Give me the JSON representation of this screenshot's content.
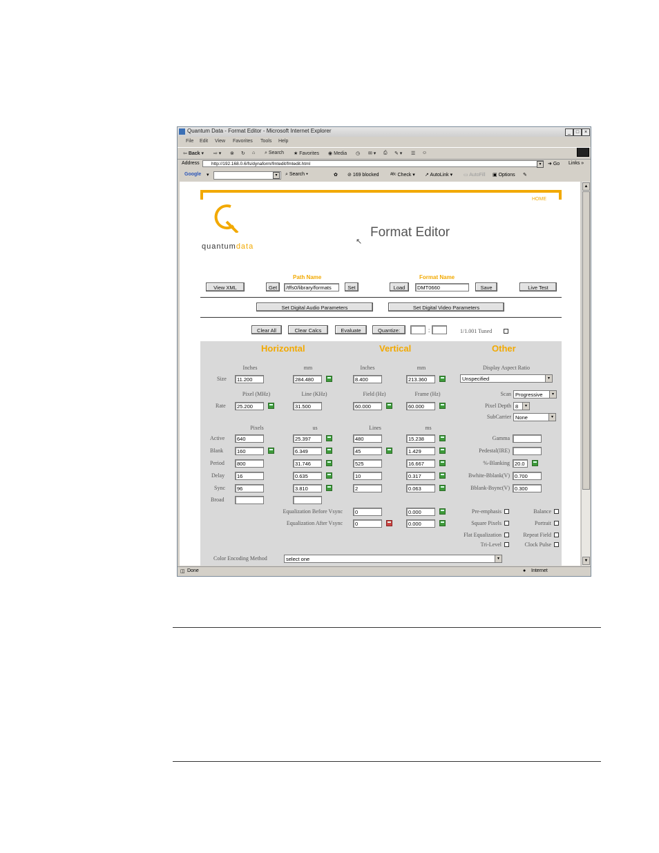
{
  "window": {
    "title": "Quantum Data - Format Editor - Microsoft Internet Explorer",
    "menu": [
      "File",
      "Edit",
      "View",
      "Favorites",
      "Tools",
      "Help"
    ],
    "toolbar": {
      "back": "Back",
      "search": "Search",
      "favorites": "Favorites",
      "media": "Media"
    },
    "address_label": "Address",
    "address": "http://192.168.0.6/fs/dynaform/fmtedit/fmtedit.html",
    "go": "Go",
    "links": "Links",
    "google": {
      "logo": "Google",
      "search": "Search",
      "blocked": "169 blocked",
      "check": "Check",
      "autolink": "AutoLink",
      "autofill": "AutoFill",
      "options": "Options"
    },
    "status": {
      "done": "Done",
      "zone": "Internet"
    }
  },
  "page": {
    "home": "HOME",
    "logo_text": "quantum",
    "logo_text2": "data",
    "title": "Format Editor",
    "path_label": "Path Name",
    "format_label": "Format Name",
    "view_xml": "View XML",
    "get": "Get",
    "path_value": "/tffs0/library/formats",
    "set": "Set",
    "load": "Load",
    "format_value": "DMT0660",
    "save": "Save",
    "live_test": "Live Test",
    "set_audio": "Set Digital Audio Parameters",
    "set_video": "Set Digital Video Parameters",
    "clear_all": "Clear All",
    "clear_calcs": "Clear Calcs",
    "evaluate": "Evaluate",
    "quantize": "Quantize:",
    "quantize_sep": ":",
    "tuned": "1/1.001 Tuned"
  },
  "sections": {
    "horizontal": "Horizontal",
    "vertical": "Vertical",
    "other": "Other"
  },
  "size": {
    "label": "Size",
    "h_inches_hdr": "Inches",
    "h_mm_hdr": "mm",
    "v_inches_hdr": "Inches",
    "v_mm_hdr": "mm",
    "h_inches": "11.200",
    "h_mm": "284.480",
    "v_inches": "8.400",
    "v_mm": "213.360",
    "aspect_hdr": "Display Aspect Ratio",
    "aspect": "Unspecified"
  },
  "rate": {
    "label": "Rate",
    "pixel_hdr": "Pixel (MHz)",
    "line_hdr": "Line (KHz)",
    "field_hdr": "Field (Hz)",
    "frame_hdr": "Frame (Hz)",
    "pixel": "25.200",
    "line": "31.500",
    "field": "60.000",
    "frame": "60.000"
  },
  "other": {
    "scan_label": "Scan",
    "scan": "Progressive",
    "pixel_depth_label": "Pixel Depth",
    "pixel_depth": "8",
    "subcarrier_label": "SubCarrier",
    "subcarrier": "None",
    "gamma_label": "Gamma",
    "gamma": "",
    "pedestal_label": "Pedestal(IRE)",
    "pedestal": "",
    "blanking_label": "%-Blanking",
    "blanking": "20.0",
    "bwhite_label": "Bwhite-Bblank(V)",
    "bwhite": "0.700",
    "bsync_label": "Bblank-Bsync(V)",
    "bsync": "0.300"
  },
  "timing": {
    "pixels_hdr": "Pixels",
    "us_hdr": "us",
    "lines_hdr": "Lines",
    "ms_hdr": "ms",
    "rows": [
      {
        "label": "Active",
        "pixels": "640",
        "us": "25.397",
        "lines": "480",
        "ms": "15.238"
      },
      {
        "label": "Blank",
        "pixels": "160",
        "us": "6.349",
        "lines": "45",
        "ms": "1.429"
      },
      {
        "label": "Period",
        "pixels": "800",
        "us": "31.746",
        "lines": "525",
        "ms": "16.667"
      },
      {
        "label": "Delay",
        "pixels": "16",
        "us": "0.635",
        "lines": "10",
        "ms": "0.317"
      },
      {
        "label": "Sync",
        "pixels": "96",
        "us": "3.810",
        "lines": "2",
        "ms": "0.063"
      },
      {
        "label": "Broad",
        "pixels": "",
        "us": ""
      }
    ]
  },
  "equalization": {
    "before_label": "Equalization Before Vsync",
    "before_lines": "0",
    "before_ms": "0.000",
    "after_label": "Equalization After Vsync",
    "after_lines": "0",
    "after_ms": "0.000"
  },
  "checks": {
    "pre_emphasis": "Pre-emphasis",
    "balance": "Balance",
    "square_pixels": "Square Pixels",
    "portrait": "Portrait",
    "flat_eq": "Flat Equalization",
    "repeat_field": "Repeat Field",
    "tri_level": "Tri-Level",
    "clock_pulse": "Clock Pulse"
  },
  "color": {
    "label": "Color Encoding Method",
    "value": "select one"
  }
}
